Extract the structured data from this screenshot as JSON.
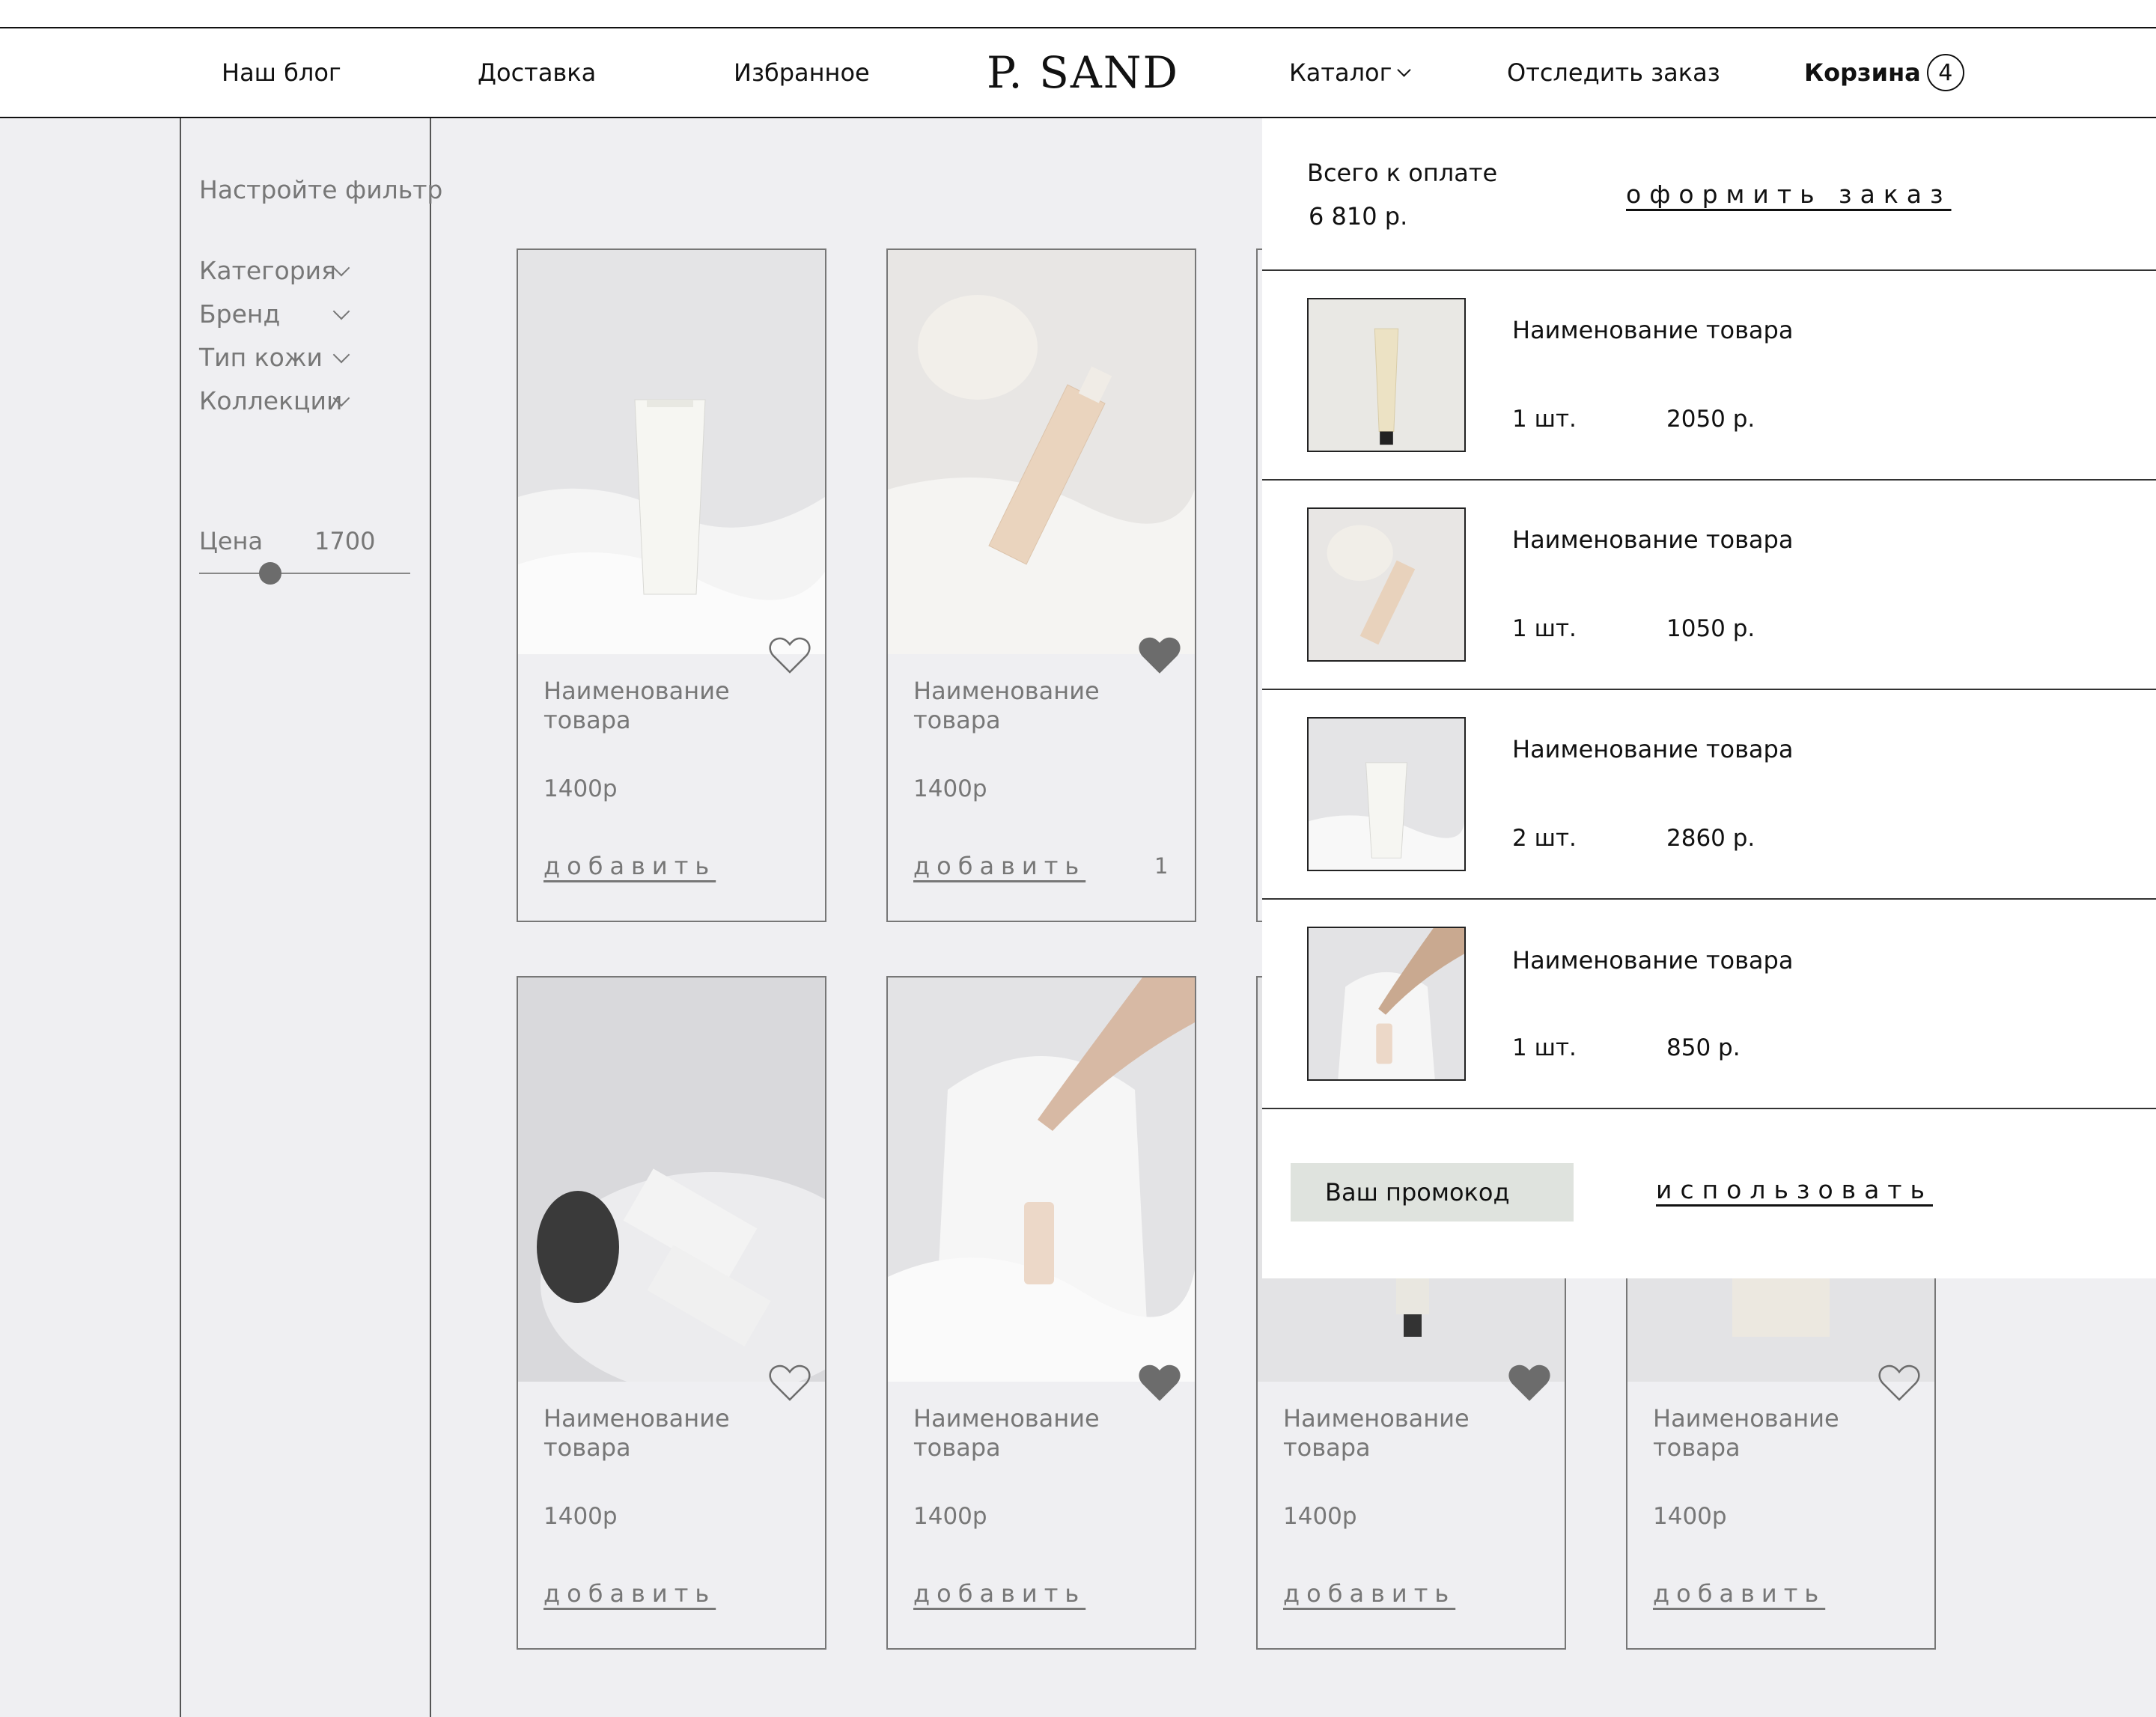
{
  "header": {
    "nav_blog": "Наш блог",
    "nav_delivery": "Доставка",
    "nav_favorites": "Избранное",
    "logo": "P. SAND",
    "nav_catalog": "Каталог",
    "nav_track": "Отследить заказ",
    "cart_label": "Корзина",
    "cart_count": "4"
  },
  "filters": {
    "title": "Настройте фильтр",
    "items": [
      "Категория",
      "Бренд",
      "Тип кожи",
      "Коллекции"
    ],
    "price_label": "Цена",
    "price_value": "1700"
  },
  "products": [
    {
      "name": "Наименование товара",
      "price": "1400р",
      "add_label": "добавить",
      "favorite": false
    },
    {
      "name": "Наименование товара",
      "price": "1400р",
      "add_label": "добавить",
      "qty": "1",
      "favorite": true
    },
    {
      "name": "Наименование товара",
      "price": "1400р",
      "add_label": "добавить",
      "favorite": false
    },
    {
      "name": "Наименование товара",
      "price": "1400р",
      "add_label": "добавить",
      "favorite": true
    },
    {
      "name": "Наименование товара",
      "price": "1400р",
      "add_label": "добавить",
      "favorite": true
    },
    {
      "name": "Наименование товара",
      "price": "1400р",
      "add_label": "добавить",
      "favorite": false
    }
  ],
  "cart": {
    "total_label": "Всего к оплате",
    "total_value": "6 810 р.",
    "checkout_label": "оформить заказ",
    "items": [
      {
        "name": "Наименование товара",
        "qty": "1 шт.",
        "price": "2050 р."
      },
      {
        "name": "Наименование товара",
        "qty": "1 шт.",
        "price": "1050 р."
      },
      {
        "name": "Наименование товара",
        "qty": "2 шт.",
        "price": "2860 р."
      },
      {
        "name": "Наименование товара",
        "qty": "1 шт.",
        "price": "850 р."
      }
    ],
    "promo_placeholder": "Ваш промокод",
    "promo_apply": "использовать"
  },
  "colors": {
    "page_background": "#efeff2",
    "promo_field": "#dfe3de",
    "muted_text": "#777777",
    "heart_filled": "#6c6c6c"
  }
}
